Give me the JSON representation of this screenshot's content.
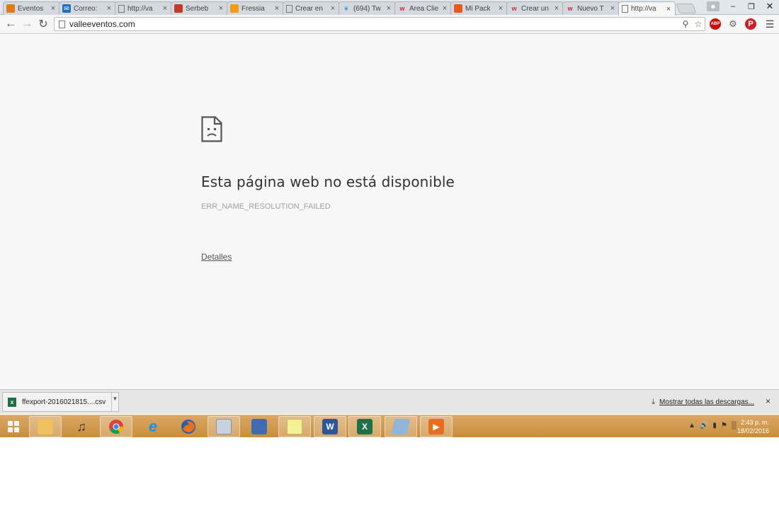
{
  "tabs": [
    {
      "label": "Eventos",
      "icon": "eventos-favicon",
      "color": "#e07b1a"
    },
    {
      "label": "Correo:",
      "icon": "mail-icon",
      "color": "#1e6fc4"
    },
    {
      "label": "http://va",
      "icon": "page-icon",
      "color": "#777777"
    },
    {
      "label": "Serbeb",
      "icon": "serbeb-favicon",
      "color": "#c0392b"
    },
    {
      "label": "Fressia",
      "icon": "fressia-favicon",
      "color": "#f39c12"
    },
    {
      "label": "Crear en",
      "icon": "page-icon",
      "color": "#777777"
    },
    {
      "label": "(694) Tw",
      "icon": "twitter-icon",
      "color": "#4a9de3"
    },
    {
      "label": "Área Clie",
      "icon": "w-favicon",
      "color": "#d6263a"
    },
    {
      "label": "Mi Pack",
      "icon": "mipack-favicon",
      "color": "#e8581f"
    },
    {
      "label": "Crear un",
      "icon": "w-favicon",
      "color": "#d6263a"
    },
    {
      "label": "Nuevo T",
      "icon": "w-favicon",
      "color": "#d6263a"
    },
    {
      "label": "http://va",
      "icon": "page-icon",
      "color": "#777777",
      "active": true
    }
  ],
  "toolbar": {
    "back": "back-arrow-icon",
    "forward": "forward-arrow-icon",
    "reload": "reload-icon",
    "url": "valleeventos.com",
    "zoom": "zoom-icon",
    "star": "bookmark-star-icon",
    "ext_abp": "ABP",
    "ext_gear": "gear-icon",
    "ext_pinterest": "P",
    "menu": "menu-icon"
  },
  "error": {
    "title": "Esta página web no está disponible",
    "code": "ERR_NAME_RESOLUTION_FAILED",
    "details": "Detalles"
  },
  "downloads": {
    "filename": "ffexport-2016021815....csv",
    "show_all": "Mostrar todas las descargas...",
    "close": "×"
  },
  "clock": {
    "time": "2:43 p. m.",
    "date": "18/02/2016"
  },
  "colors": {
    "page_bg": "#f7f7f7",
    "taskbar": "#c98d3c",
    "abp": "#c70d0d",
    "pinterest": "#cb2027"
  }
}
